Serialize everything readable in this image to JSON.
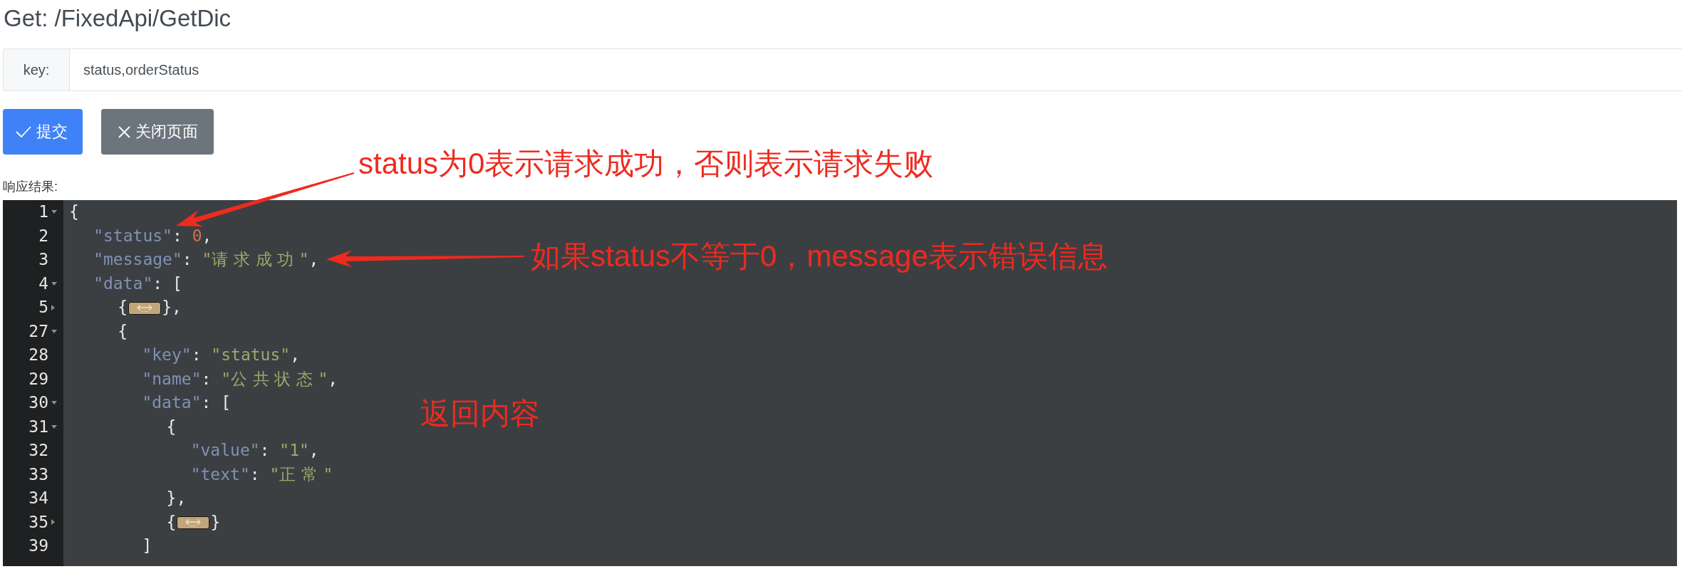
{
  "header": {
    "title": "Get: /FixedApi/GetDic"
  },
  "form": {
    "label": "key:",
    "value": "status,orderStatus"
  },
  "buttons": [
    {
      "kind": "submit",
      "label": "提交"
    },
    {
      "kind": "close",
      "label": "关闭页面"
    }
  ],
  "response": {
    "label": "响应结果:",
    "editor": {
      "lines": [
        {
          "number": "1",
          "foldable": true,
          "expanded": true,
          "tokens": [
            {
              "kind": "punct",
              "text": "{"
            }
          ]
        },
        {
          "number": "2",
          "foldable": false,
          "tokens": [
            {
              "kind": "key",
              "text": "  \"status\""
            },
            {
              "kind": "punct",
              "text": ": "
            },
            {
              "kind": "number",
              "text": "0"
            },
            {
              "kind": "punct",
              "text": ","
            }
          ]
        },
        {
          "number": "3",
          "foldable": false,
          "tokens": [
            {
              "kind": "key",
              "text": "  \"message\""
            },
            {
              "kind": "punct",
              "text": ": "
            },
            {
              "kind": "string",
              "text": "\"请求成功\""
            },
            {
              "kind": "punct",
              "text": ","
            }
          ]
        },
        {
          "number": "4",
          "foldable": true,
          "expanded": true,
          "tokens": [
            {
              "kind": "key",
              "text": "  \"data\""
            },
            {
              "kind": "punct",
              "text": ": ["
            }
          ]
        },
        {
          "number": "5",
          "foldable": true,
          "expanded": false,
          "tokens": [
            {
              "kind": "punct",
              "text": "    {"
            },
            {
              "kind": "folded"
            },
            {
              "kind": "punct",
              "text": "},"
            }
          ]
        },
        {
          "number": "27",
          "foldable": true,
          "expanded": true,
          "tokens": [
            {
              "kind": "punct",
              "text": "    {"
            }
          ]
        },
        {
          "number": "28",
          "foldable": false,
          "tokens": [
            {
              "kind": "key",
              "text": "      \"key\""
            },
            {
              "kind": "punct",
              "text": ": "
            },
            {
              "kind": "string",
              "text": "\"status\""
            },
            {
              "kind": "punct",
              "text": ","
            }
          ]
        },
        {
          "number": "29",
          "foldable": false,
          "tokens": [
            {
              "kind": "key",
              "text": "      \"name\""
            },
            {
              "kind": "punct",
              "text": ": "
            },
            {
              "kind": "string",
              "text": "\"公共状态\""
            },
            {
              "kind": "punct",
              "text": ","
            }
          ]
        },
        {
          "number": "30",
          "foldable": true,
          "expanded": true,
          "tokens": [
            {
              "kind": "key",
              "text": "      \"data\""
            },
            {
              "kind": "punct",
              "text": ": ["
            }
          ]
        },
        {
          "number": "31",
          "foldable": true,
          "expanded": true,
          "tokens": [
            {
              "kind": "punct",
              "text": "        {"
            }
          ]
        },
        {
          "number": "32",
          "foldable": false,
          "tokens": [
            {
              "kind": "key",
              "text": "          \"value\""
            },
            {
              "kind": "punct",
              "text": ": "
            },
            {
              "kind": "string",
              "text": "\"1\""
            },
            {
              "kind": "punct",
              "text": ","
            }
          ]
        },
        {
          "number": "33",
          "foldable": false,
          "tokens": [
            {
              "kind": "key",
              "text": "          \"text\""
            },
            {
              "kind": "punct",
              "text": ": "
            },
            {
              "kind": "string",
              "text": "\"正常\""
            }
          ]
        },
        {
          "number": "34",
          "foldable": false,
          "tokens": [
            {
              "kind": "punct",
              "text": "        },"
            }
          ]
        },
        {
          "number": "35",
          "foldable": true,
          "expanded": false,
          "tokens": [
            {
              "kind": "punct",
              "text": "        {"
            },
            {
              "kind": "folded"
            },
            {
              "kind": "punct",
              "text": "}"
            }
          ]
        },
        {
          "number": "39",
          "foldable": false,
          "tokens": [
            {
              "kind": "punct",
              "text": "      ]"
            }
          ]
        }
      ]
    }
  },
  "annotations": [
    {
      "text": "status为0表示请求成功，否则表示请求失败",
      "arrow": true
    },
    {
      "text": "如果status不等于0，message表示错误信息",
      "arrow": true
    },
    {
      "text": "返回内容",
      "arrow": false
    }
  ]
}
